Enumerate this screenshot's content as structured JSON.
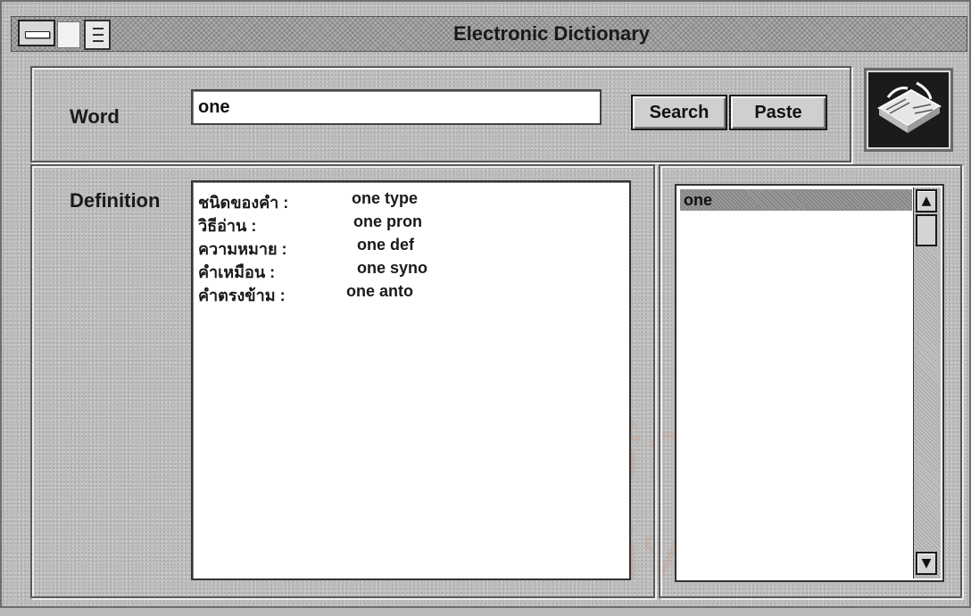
{
  "window": {
    "title": "Electronic Dictionary"
  },
  "search": {
    "word_label": "Word",
    "word_value": "one",
    "search_button": "Search",
    "paste_button": "Paste"
  },
  "definition": {
    "label": "Definition",
    "rows": [
      {
        "key": "ชนิดของคำ :",
        "value": "one type"
      },
      {
        "key": "วิธีอ่าน :",
        "value": "one pron"
      },
      {
        "key": "ความหมาย :",
        "value": "one def"
      },
      {
        "key": "คำเหมือน :",
        "value": "one syno"
      },
      {
        "key": "คำตรงข้าม :",
        "value": "one anto"
      }
    ]
  },
  "word_list": {
    "items": [
      "one"
    ],
    "selected": "one",
    "scroll_up_icon": "arrow-up-icon",
    "scroll_down_icon": "arrow-down-icon"
  },
  "icons": {
    "system_menu": "system-menu-icon",
    "window_icon": "window-icon",
    "document_icon": "document-icon",
    "app_logo": "open-book-icon"
  },
  "watermark": {
    "line1": "ถาบันวิทยบริการ",
    "line2": "ลงกรณ์มหาวิทยาลัย"
  }
}
